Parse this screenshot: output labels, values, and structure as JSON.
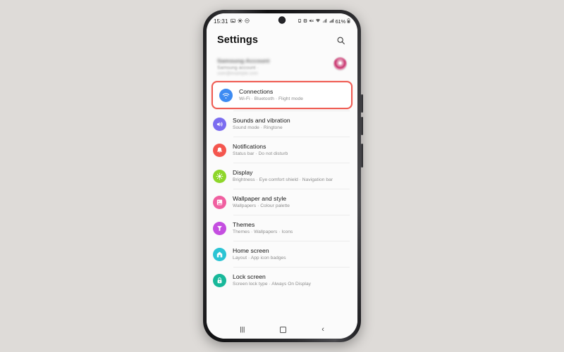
{
  "background_color": "#dedbd8",
  "phone": {
    "status_bar": {
      "time": "15:31",
      "left_icons": [
        "image-icon",
        "brightness-icon",
        "do-not-disturb-icon"
      ],
      "right_icons": [
        "nfc-icon",
        "screenshot-icon",
        "mute-icon",
        "wifi-icon",
        "data-icon",
        "signal-icon"
      ],
      "battery_text": "61%",
      "battery_icon": "battery-icon",
      "camera": "front-camera-punch-hole"
    },
    "header": {
      "title": "Settings",
      "search_icon": "search-icon"
    },
    "account": {
      "name": "Samsung Account",
      "subtitle": "Samsung account  ·",
      "email": "user@example.com",
      "avatar": "profile-avatar"
    },
    "highlight_color": "#ef5b52",
    "items": [
      {
        "id": "connections",
        "title": "Connections",
        "subtitle": "Wi-Fi  ·  Bluetooth  ·  Flight mode",
        "icon": "wifi-icon",
        "icon_color": "#3d8bf2",
        "highlighted": true
      },
      {
        "id": "sounds-and-vibration",
        "title": "Sounds and vibration",
        "subtitle": "Sound mode  ·  Ringtone",
        "icon": "speaker-icon",
        "icon_color": "#7b6cf0",
        "highlighted": false
      },
      {
        "id": "notifications",
        "title": "Notifications",
        "subtitle": "Status bar  ·  Do not disturb",
        "icon": "notification-bell-icon",
        "icon_color": "#f4564e",
        "highlighted": false
      },
      {
        "id": "display",
        "title": "Display",
        "subtitle": "Brightness  ·  Eye comfort shield  ·  Navigation bar",
        "icon": "brightness-icon",
        "icon_color": "#8ed62a",
        "highlighted": false
      },
      {
        "id": "wallpaper-and-style",
        "title": "Wallpaper and style",
        "subtitle": "Wallpapers  ·  Colour palette",
        "icon": "wallpaper-icon",
        "icon_color": "#f05fa0",
        "highlighted": false
      },
      {
        "id": "themes",
        "title": "Themes",
        "subtitle": "Themes  ·  Wallpapers  ·  Icons",
        "icon": "themes-icon",
        "icon_color": "#c44ee0",
        "highlighted": false
      },
      {
        "id": "home-screen",
        "title": "Home screen",
        "subtitle": "Layout  ·  App icon badges",
        "icon": "home-icon",
        "icon_color": "#2bc4d4",
        "highlighted": false
      },
      {
        "id": "lock-screen",
        "title": "Lock screen",
        "subtitle": "Screen lock type  ·  Always On Display",
        "icon": "lock-icon",
        "icon_color": "#18b89a",
        "highlighted": false
      }
    ],
    "nav_bar": {
      "recents_label": "|||",
      "recents_icon": "recents-icon",
      "home_icon": "home-square-icon",
      "back_label": "‹",
      "back_icon": "back-icon"
    },
    "side_buttons": [
      "volume-up-button",
      "volume-down-button",
      "power-button"
    ]
  }
}
